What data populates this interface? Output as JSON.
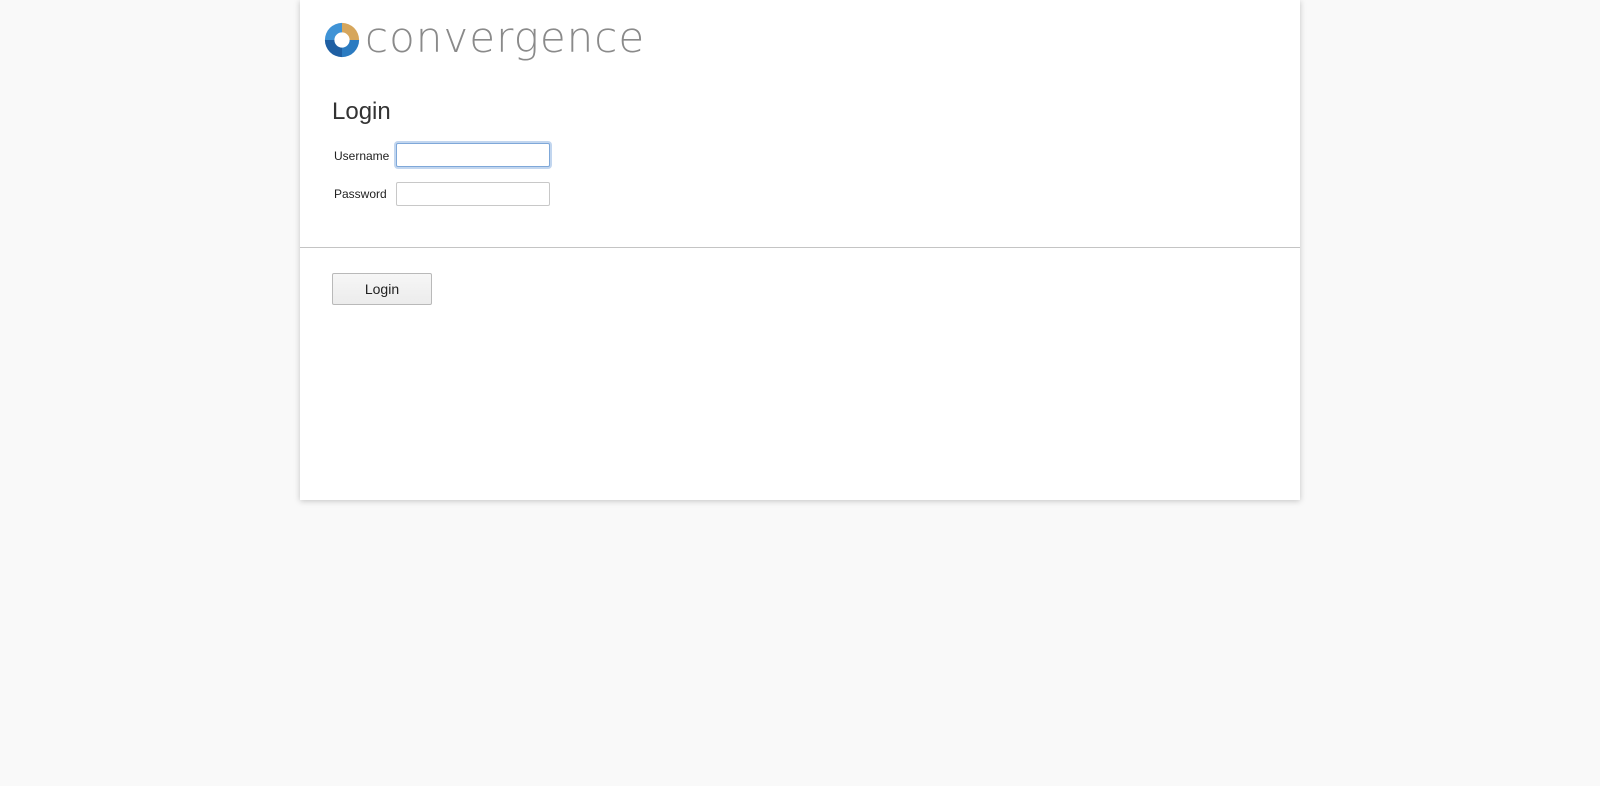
{
  "logo": {
    "text": "convergence",
    "colors": {
      "blue": "#2b7bc1",
      "gold": "#d6a65c",
      "text": "#8a8a8a"
    }
  },
  "form": {
    "title": "Login",
    "username_label": "Username",
    "username_value": "",
    "password_label": "Password",
    "password_value": ""
  },
  "actions": {
    "login_label": "Login"
  }
}
